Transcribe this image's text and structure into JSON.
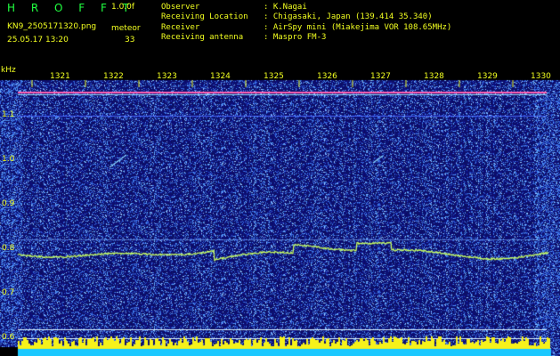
{
  "header": {
    "brand": "H R O F F T",
    "version": "1.0.0f",
    "filename": "KN9_2505171320.png",
    "meteor_label": "meteor",
    "datetime": "25.05.17 13:20",
    "meteor_count": "33"
  },
  "info": [
    {
      "label": "Observer",
      "value": ": K.Nagai"
    },
    {
      "label": "Receiving Location",
      "value": ": Chigasaki, Japan (139.414 35.340)"
    },
    {
      "label": "Receiver",
      "value": ": AirSpy mini (Miakejima VOR 108.65MHz)"
    },
    {
      "label": "Receiving antenna",
      "value": ": Maspro FM-3"
    }
  ],
  "plot": {
    "y_unit": "kHz",
    "y_ticks": [
      "1.1",
      "1.0",
      "0.9",
      "0.8",
      "0.7",
      "0.6"
    ],
    "x_ticks": [
      "1321",
      "1322",
      "1323",
      "1324",
      "1325",
      "1326",
      "1327",
      "1328",
      "1329",
      "1330"
    ],
    "colors": {
      "background": "#0a0a6a",
      "noise": "#3a5cff",
      "carrier": "#ff60b0",
      "trace": "#c8ff60",
      "bars": "#f6f21a",
      "bottom": "#1ac8ff",
      "axis_text": "#f2ff20"
    }
  }
}
